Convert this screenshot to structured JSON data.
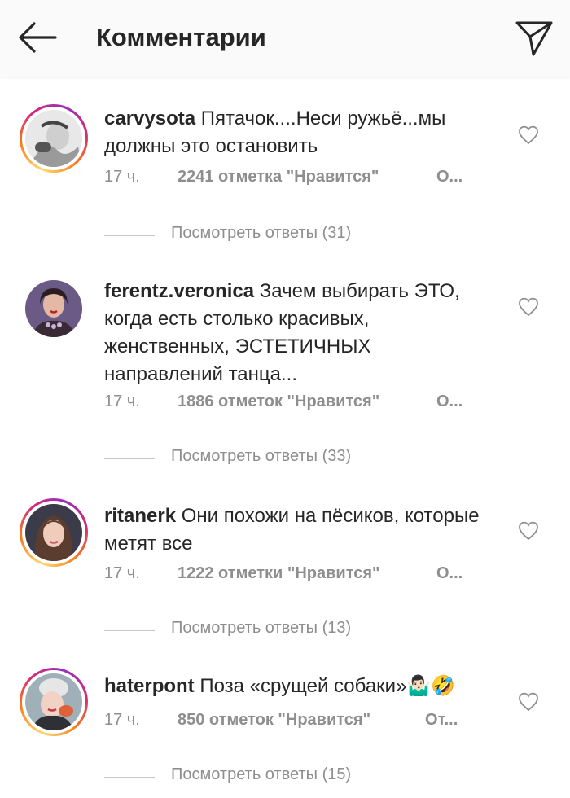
{
  "header": {
    "title": "Комментарии",
    "back_icon": "arrow-left-icon",
    "send_icon": "paper-plane-icon"
  },
  "comments": [
    {
      "username": "carvysota",
      "text": "Пятачок....Неси ружьё...мы должны это остановить",
      "time": "17 ч.",
      "likes": "2241 отметка \"Нравится\"",
      "reply": "О...",
      "view_replies": "Посмотреть ответы (31)",
      "has_story": true
    },
    {
      "username": "ferentz.veronica",
      "text": "Зачем выбирать ЭТО, когда есть столько красивых, женственных, ЭСТЕТИЧНЫХ направлений танца...",
      "time": "17 ч.",
      "likes": "1886 отметок \"Нравится\"",
      "reply": "О...",
      "view_replies": "Посмотреть ответы (33)",
      "has_story": false
    },
    {
      "username": "ritanerk",
      "text": "Они похожи на пёсиков, которые метят все",
      "time": "17 ч.",
      "likes": "1222 отметки \"Нравится\"",
      "reply": "О...",
      "view_replies": "Посмотреть ответы (13)",
      "has_story": true
    },
    {
      "username": "haterpont",
      "text": "Поза «срущей собаки»🤷🏻‍♂️🤣",
      "time": "17 ч.",
      "likes": "850 отметок \"Нравится\"",
      "reply": "От...",
      "view_replies": "Посмотреть ответы (15)",
      "has_story": true
    }
  ],
  "colors": {
    "text": "#262626",
    "secondary": "#8e8e8e",
    "header_bg": "#fafafa",
    "divider": "#dbdbdb"
  }
}
